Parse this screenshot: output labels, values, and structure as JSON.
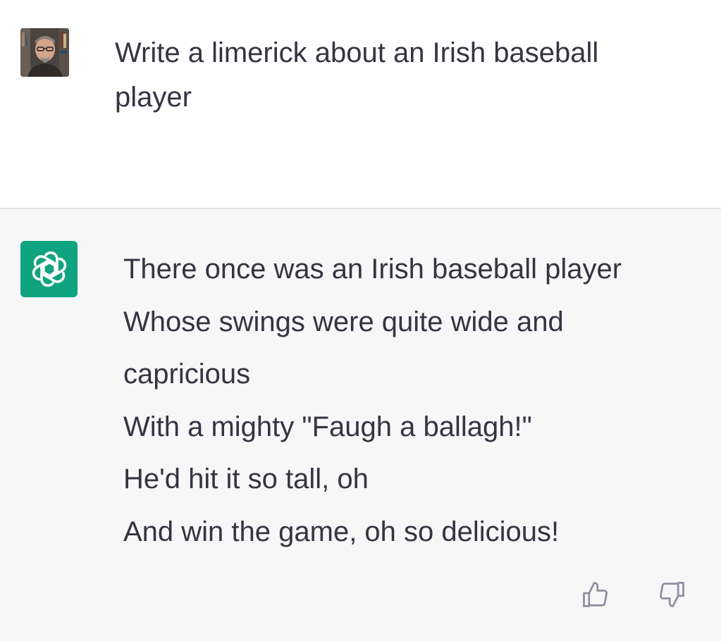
{
  "user_message": {
    "avatar_icon": "user-photo-avatar",
    "text": "Write a limerick about an Irish baseball player"
  },
  "assistant_message": {
    "avatar_icon": "openai-logo-icon",
    "brand_color": "#10a37f",
    "lines": [
      "There once was an Irish baseball player",
      "Whose swings were quite wide and",
      "capricious",
      "With a mighty \"Faugh a ballagh!\"",
      "He'd hit it so tall, oh",
      "And win the game, oh so delicious!"
    ]
  },
  "feedback": {
    "thumbs_up_icon": "thumbs-up-icon",
    "thumbs_down_icon": "thumbs-down-icon"
  }
}
